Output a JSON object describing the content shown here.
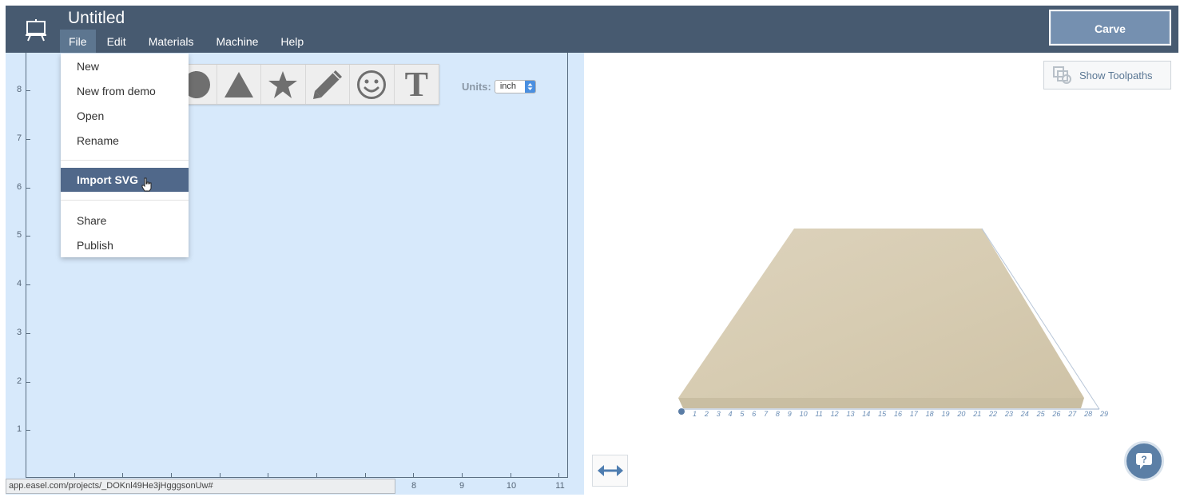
{
  "header": {
    "title": "Untitled",
    "menu": [
      {
        "label": "File",
        "active": true
      },
      {
        "label": "Edit"
      },
      {
        "label": "Materials"
      },
      {
        "label": "Machine"
      },
      {
        "label": "Help"
      }
    ],
    "carve_label": "Carve",
    "app_icon": "easel-icon"
  },
  "file_menu": {
    "items": [
      "New",
      "New from demo",
      "Open",
      "Rename",
      "Import SVG",
      "Share",
      "Publish"
    ],
    "highlighted": "Import SVG"
  },
  "shape_toolbar": {
    "tools": [
      "circle-icon",
      "triangle-icon",
      "star-icon",
      "pencil-icon",
      "smiley-icon",
      "text-icon"
    ],
    "text_tool_glyph": "T"
  },
  "units": {
    "label": "Units:",
    "value": "inch"
  },
  "canvas": {
    "y_ticks": [
      "8",
      "7",
      "6",
      "5",
      "4",
      "3",
      "2",
      "1"
    ],
    "x_ticks": [
      "8",
      "9",
      "10",
      "11"
    ]
  },
  "status_url": "app.easel.com/projects/_DOKnl49He3jHgggsonUw#",
  "preview": {
    "show_toolpaths_label": "Show Toolpaths",
    "ruler_numbers": [
      "1",
      "2",
      "3",
      "4",
      "5",
      "6",
      "7",
      "8",
      "9",
      "10",
      "11",
      "12",
      "13",
      "14",
      "15",
      "16",
      "17",
      "18",
      "19",
      "20",
      "21",
      "22",
      "23",
      "24",
      "25",
      "26",
      "27",
      "28",
      "29"
    ]
  },
  "colors": {
    "header_bg": "#475a70",
    "canvas_bg": "#d7e9fb",
    "highlight": "#50688a",
    "carve_bg": "#7590b0",
    "accent": "#5b7fa6"
  }
}
